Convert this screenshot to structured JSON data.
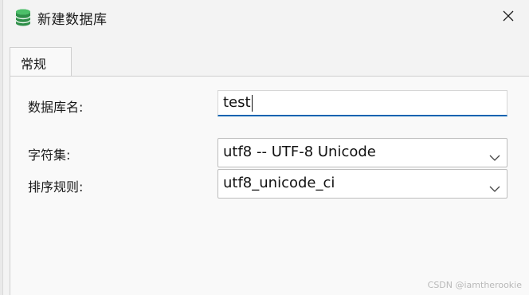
{
  "window": {
    "title": "新建数据库",
    "icon": "database-icon",
    "close_icon": "close-icon"
  },
  "tabs": [
    {
      "label": "常规",
      "active": true
    }
  ],
  "form": {
    "db_name_label": "数据库名:",
    "db_name_value": "test",
    "charset_label": "字符集:",
    "charset_value": "utf8 -- UTF-8 Unicode",
    "collation_label": "排序规则:",
    "collation_value": "utf8_unicode_ci"
  },
  "watermark": "CSDN @iamtherookie",
  "colors": {
    "accent": "#0063b1",
    "icon_green": "#3aa655"
  }
}
